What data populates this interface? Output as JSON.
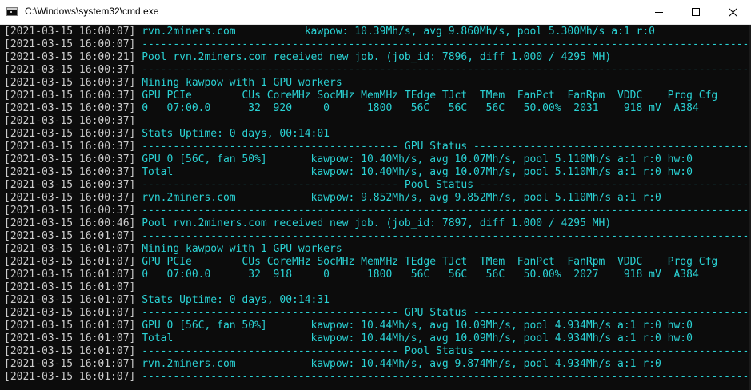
{
  "window": {
    "title": "C:\\Windows\\system32\\cmd.exe"
  },
  "console": {
    "lines": [
      {
        "ts": "[2021-03-15 16:00:07]",
        "msg": " rvn.2miners.com           kawpow: 10.39Mh/s, avg 9.860Mh/s, pool 5.300Mh/s a:1 r:0"
      },
      {
        "ts": "[2021-03-15 16:00:07]",
        "msg": " -----------------------------------------------------------------------------------------------------------"
      },
      {
        "ts": "[2021-03-15 16:00:21]",
        "msg": " Pool rvn.2miners.com received new job. (job_id: 7896, diff 1.000 / 4295 MH)"
      },
      {
        "ts": "[2021-03-15 16:00:37]",
        "msg": " -----------------------------------------------------------------------------------------------------------"
      },
      {
        "ts": "[2021-03-15 16:00:37]",
        "msg": " Mining kawpow with 1 GPU workers"
      },
      {
        "ts": "[2021-03-15 16:00:37]",
        "msg": " GPU PCIe        CUs CoreMHz SocMHz MemMHz TEdge TJct  TMem  FanPct  FanRpm  VDDC    Prog Cfg"
      },
      {
        "ts": "[2021-03-15 16:00:37]",
        "msg": " 0   07:00.0      32  920     0      1800   56C   56C   56C   50.00%  2031    918 mV  A384"
      },
      {
        "ts": "[2021-03-15 16:00:37]",
        "msg": ""
      },
      {
        "ts": "[2021-03-15 16:00:37]",
        "msg": " Stats Uptime: 0 days, 00:14:01"
      },
      {
        "ts": "[2021-03-15 16:00:37]",
        "msg": " ----------------------------------------- GPU Status -----------------------------------------------------"
      },
      {
        "ts": "[2021-03-15 16:00:37]",
        "msg": " GPU 0 [56C, fan 50%]       kawpow: 10.40Mh/s, avg 10.07Mh/s, pool 5.110Mh/s a:1 r:0 hw:0"
      },
      {
        "ts": "[2021-03-15 16:00:37]",
        "msg": " Total                      kawpow: 10.40Mh/s, avg 10.07Mh/s, pool 5.110Mh/s a:1 r:0 hw:0"
      },
      {
        "ts": "[2021-03-15 16:00:37]",
        "msg": " ----------------------------------------- Pool Status ----------------------------------------------------"
      },
      {
        "ts": "[2021-03-15 16:00:37]",
        "msg": " rvn.2miners.com            kawpow: 9.852Mh/s, avg 9.852Mh/s, pool 5.110Mh/s a:1 r:0"
      },
      {
        "ts": "[2021-03-15 16:00:37]",
        "msg": " -----------------------------------------------------------------------------------------------------------"
      },
      {
        "ts": "[2021-03-15 16:00:46]",
        "msg": " Pool rvn.2miners.com received new job. (job_id: 7897, diff 1.000 / 4295 MH)"
      },
      {
        "ts": "[2021-03-15 16:01:07]",
        "msg": " -----------------------------------------------------------------------------------------------------------"
      },
      {
        "ts": "[2021-03-15 16:01:07]",
        "msg": " Mining kawpow with 1 GPU workers"
      },
      {
        "ts": "[2021-03-15 16:01:07]",
        "msg": " GPU PCIe        CUs CoreMHz SocMHz MemMHz TEdge TJct  TMem  FanPct  FanRpm  VDDC    Prog Cfg"
      },
      {
        "ts": "[2021-03-15 16:01:07]",
        "msg": " 0   07:00.0      32  918     0      1800   56C   56C   56C   50.00%  2027    918 mV  A384"
      },
      {
        "ts": "[2021-03-15 16:01:07]",
        "msg": ""
      },
      {
        "ts": "[2021-03-15 16:01:07]",
        "msg": " Stats Uptime: 0 days, 00:14:31"
      },
      {
        "ts": "[2021-03-15 16:01:07]",
        "msg": " ----------------------------------------- GPU Status -----------------------------------------------------"
      },
      {
        "ts": "[2021-03-15 16:01:07]",
        "msg": " GPU 0 [56C, fan 50%]       kawpow: 10.44Mh/s, avg 10.09Mh/s, pool 4.934Mh/s a:1 r:0 hw:0"
      },
      {
        "ts": "[2021-03-15 16:01:07]",
        "msg": " Total                      kawpow: 10.44Mh/s, avg 10.09Mh/s, pool 4.934Mh/s a:1 r:0 hw:0"
      },
      {
        "ts": "[2021-03-15 16:01:07]",
        "msg": " ----------------------------------------- Pool Status ----------------------------------------------------"
      },
      {
        "ts": "[2021-03-15 16:01:07]",
        "msg": " rvn.2miners.com            kawpow: 10.44Mh/s, avg 9.874Mh/s, pool 4.934Mh/s a:1 r:0"
      },
      {
        "ts": "[2021-03-15 16:01:07]",
        "msg": " -----------------------------------------------------------------------------------------------------------"
      },
      {
        "ts": "",
        "msg": ""
      }
    ]
  }
}
